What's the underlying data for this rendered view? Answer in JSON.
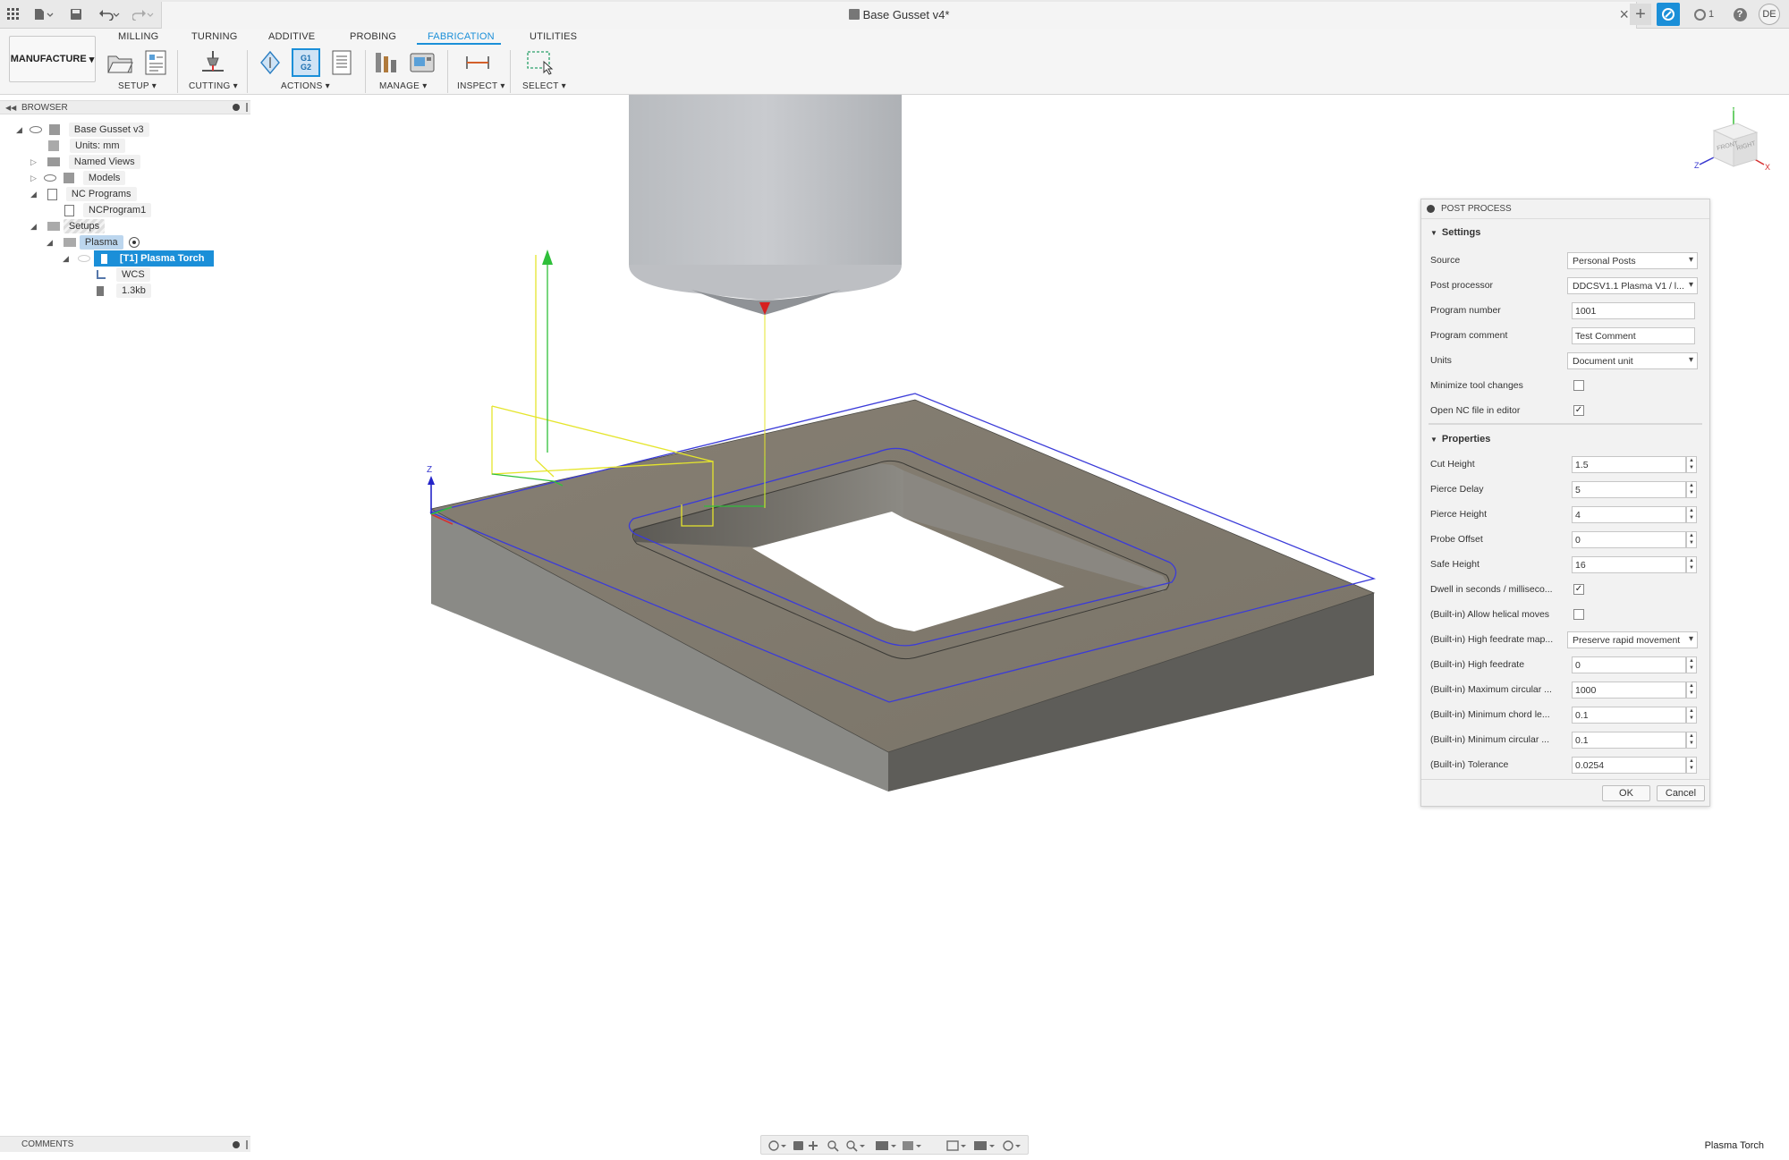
{
  "app": {
    "document_title": "Base Gusset v4*",
    "user_initials": "DE",
    "notification_count": "1",
    "workspace_label": "MANUFACTURE"
  },
  "toolbar": {
    "tabs": [
      "MILLING",
      "TURNING",
      "ADDITIVE",
      "PROBING",
      "FABRICATION",
      "UTILITIES"
    ],
    "active_tab": "FABRICATION",
    "groups": [
      "SETUP",
      "CUTTING",
      "ACTIONS",
      "MANAGE",
      "INSPECT",
      "SELECT"
    ],
    "post_icon_text": "G1 G2"
  },
  "browser": {
    "title": "BROWSER",
    "items": [
      {
        "label": "Base Gusset v3"
      },
      {
        "label": "Units: mm"
      },
      {
        "label": "Named Views"
      },
      {
        "label": "Models"
      },
      {
        "label": "NC Programs"
      },
      {
        "label": "NCProgram1"
      },
      {
        "label": "Setups"
      },
      {
        "label": "Plasma"
      },
      {
        "label": "[T1] Plasma Torch"
      },
      {
        "label": "WCS"
      },
      {
        "label": "1.3kb"
      }
    ]
  },
  "viewcube": {
    "front": "FRONT",
    "right": "RIGHT",
    "axis_x": "X",
    "axis_y": "Y",
    "axis_z": "Z"
  },
  "viewport": {
    "axis_label": "Z"
  },
  "post_process": {
    "title": "POST PROCESS",
    "settings_title": "Settings",
    "properties_title": "Properties",
    "settings": {
      "source": {
        "label": "Source",
        "value": "Personal Posts"
      },
      "post_processor": {
        "label": "Post processor",
        "value": "DDCSV1.1 Plasma V1 / l..."
      },
      "program_number": {
        "label": "Program number",
        "value": "1001"
      },
      "program_comment": {
        "label": "Program comment",
        "value": "Test Comment"
      },
      "units": {
        "label": "Units",
        "value": "Document unit"
      },
      "minimize_tool_changes": {
        "label": "Minimize tool changes",
        "checked": false
      },
      "open_nc_file": {
        "label": "Open NC file in editor",
        "checked": true
      }
    },
    "properties": {
      "cut_height": {
        "label": "Cut Height",
        "value": "1.5"
      },
      "pierce_delay": {
        "label": "Pierce Delay",
        "value": "5"
      },
      "pierce_height": {
        "label": "Pierce Height",
        "value": "4"
      },
      "probe_offset": {
        "label": "Probe Offset",
        "value": "0"
      },
      "safe_height": {
        "label": "Safe Height",
        "value": "16"
      },
      "dwell": {
        "label": "Dwell in seconds / milliseco...",
        "checked": true
      },
      "helical": {
        "label": "(Built-in) Allow helical moves",
        "checked": false
      },
      "high_feed_map": {
        "label": "(Built-in) High feedrate map...",
        "value": "Preserve rapid movement"
      },
      "high_feed": {
        "label": "(Built-in) High feedrate",
        "value": "0"
      },
      "max_circ": {
        "label": "(Built-in) Maximum circular ...",
        "value": "1000"
      },
      "min_chord": {
        "label": "(Built-in) Minimum chord le...",
        "value": "0.1"
      },
      "min_circ": {
        "label": "(Built-in) Minimum circular ...",
        "value": "0.1"
      },
      "tolerance": {
        "label": "(Built-in) Tolerance",
        "value": "0.0254"
      }
    },
    "ok_label": "OK",
    "cancel_label": "Cancel"
  },
  "comments": {
    "title": "COMMENTS"
  },
  "status": {
    "right_text": "Plasma Torch"
  }
}
